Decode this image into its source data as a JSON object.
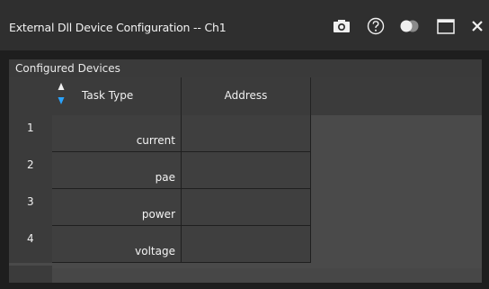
{
  "window": {
    "title": "External Dll Device Configuration -- Ch1",
    "icons": [
      "camera-icon",
      "help-icon",
      "toggle-icon",
      "maximize-icon",
      "close-icon"
    ]
  },
  "section": {
    "title": "Configured Devices"
  },
  "table": {
    "columns": [
      "Task Type",
      "Address"
    ],
    "rows": [
      {
        "index": "1",
        "task_type": "current",
        "address": ""
      },
      {
        "index": "2",
        "task_type": "pae",
        "address": ""
      },
      {
        "index": "3",
        "task_type": "power",
        "address": ""
      },
      {
        "index": "4",
        "task_type": "voltage",
        "address": ""
      }
    ]
  },
  "colors": {
    "sort_arrow_active": "#29a3ff"
  }
}
